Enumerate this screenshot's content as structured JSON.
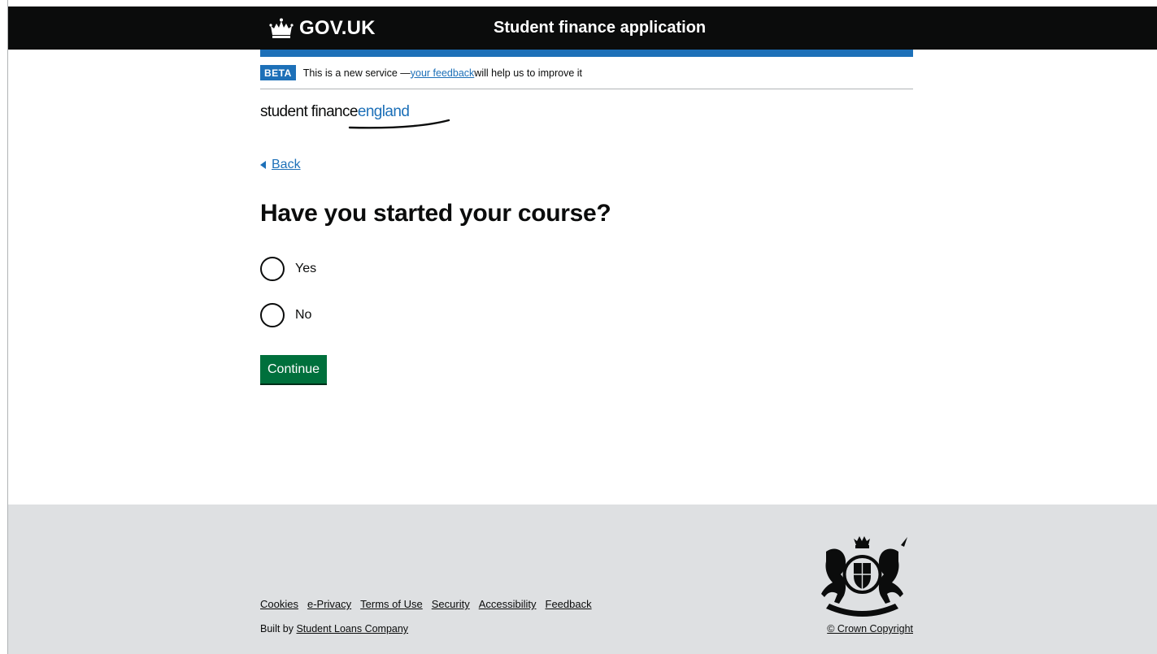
{
  "header": {
    "logotype": "GOV.UK",
    "service_name": "Student finance application"
  },
  "phase_banner": {
    "tag": "BETA",
    "text_before": "This is a new service — ",
    "link": "your feedback",
    "text_after": " will help us to improve it"
  },
  "brand": {
    "part1": "student finance",
    "part2": "england"
  },
  "nav": {
    "back": "Back"
  },
  "question": {
    "heading": "Have you started your course?",
    "options": [
      {
        "label": "Yes"
      },
      {
        "label": "No"
      }
    ]
  },
  "actions": {
    "continue": "Continue"
  },
  "footer": {
    "links": [
      "Cookies",
      "e-Privacy",
      "Terms of Use",
      "Security",
      "Accessibility",
      "Feedback"
    ],
    "built_by_prefix": "Built by ",
    "built_by_link": "Student Loans Company",
    "copyright": "© Crown Copyright"
  },
  "colors": {
    "header_bg": "#0b0c0c",
    "brand_blue": "#1d70b8",
    "button_green": "#00703c",
    "footer_bg": "#dee0e2"
  }
}
